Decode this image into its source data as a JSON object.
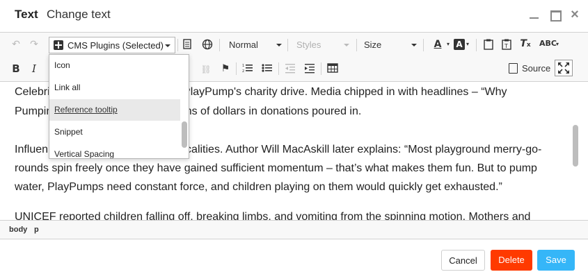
{
  "header": {
    "title": "Text",
    "subtitle": "Change text"
  },
  "toolbar": {
    "undo_icon": "undo-icon",
    "redo_icon": "redo-icon",
    "cms_plugins_label": "CMS Plugins (Selected)",
    "format_label": "Normal",
    "styles_label": "Styles",
    "size_label": "Size",
    "source_label": "Source"
  },
  "dropdown": {
    "items": [
      {
        "label": "Icon"
      },
      {
        "label": "Link all"
      },
      {
        "label": "Reference tooltip"
      },
      {
        "label": "Snippet"
      },
      {
        "label": "Vertical Spacing"
      }
    ],
    "selected": "Reference tooltip"
  },
  "content": {
    "p1_line1_start": "Celebri",
    "p1_line1_end": "d PlayPump's charity drive. Media chipped in with headlines – “Why",
    "p1_line2_start": "Pumpin",
    "p1_line2_end": "ions of dollars in donations poured in.",
    "p2_line1_start": "Influen",
    "p2_line1_end": "ticalities. Author Will MacAskill later explains: “Most playground merry-go-",
    "p2_line2": "rounds spin freely once they have gained sufficient momentum – that’s what makes them fun. But to pump",
    "p2_line3": "water, PlayPumps need constant force, and children playing on them would quickly get exhausted.”",
    "p3_line1": "UNICEF reported children falling off, breaking limbs, and vomiting from the spinning motion. Mothers and"
  },
  "pathbar": {
    "items": [
      "body",
      "p"
    ]
  },
  "footer": {
    "cancel_label": "Cancel",
    "delete_label": "Delete",
    "save_label": "Save"
  },
  "colors": {
    "delete": "#ff3a00",
    "save": "#35b6f8"
  }
}
